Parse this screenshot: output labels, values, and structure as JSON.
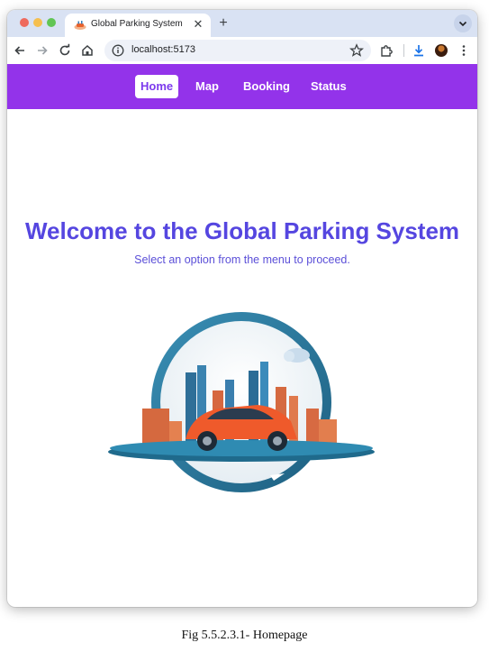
{
  "browser": {
    "tab": {
      "title": "Global Parking System",
      "close_icon": "close-icon",
      "favicon": "parking-car-favicon"
    },
    "new_tab_icon": "plus-icon",
    "tab_menu_icon": "chevron-down-icon",
    "toolbar": {
      "back_icon": "arrow-left-icon",
      "forward_icon": "arrow-right-icon",
      "reload_icon": "reload-icon",
      "home_icon": "home-icon",
      "site_info_icon": "info-icon",
      "url": "localhost:5173",
      "bookmark_icon": "star-icon",
      "extensions_icon": "puzzle-icon",
      "download_icon": "download-icon",
      "profile_icon": "avatar-icon",
      "menu_icon": "kebab-menu-icon"
    }
  },
  "nav": {
    "items": [
      {
        "label": "Home",
        "active": true
      },
      {
        "label": "Map",
        "active": false
      },
      {
        "label": "Booking",
        "active": false
      },
      {
        "label": "Status",
        "active": false
      }
    ],
    "accent_color": "#9333ea"
  },
  "hero": {
    "title": "Welcome to the Global Parking System",
    "subtitle": "Select an option from the menu to proceed.",
    "title_color": "#5546e0",
    "illustration": "city-car-circle-illustration"
  },
  "caption": "Fig 5.5.2.3.1- Homepage"
}
